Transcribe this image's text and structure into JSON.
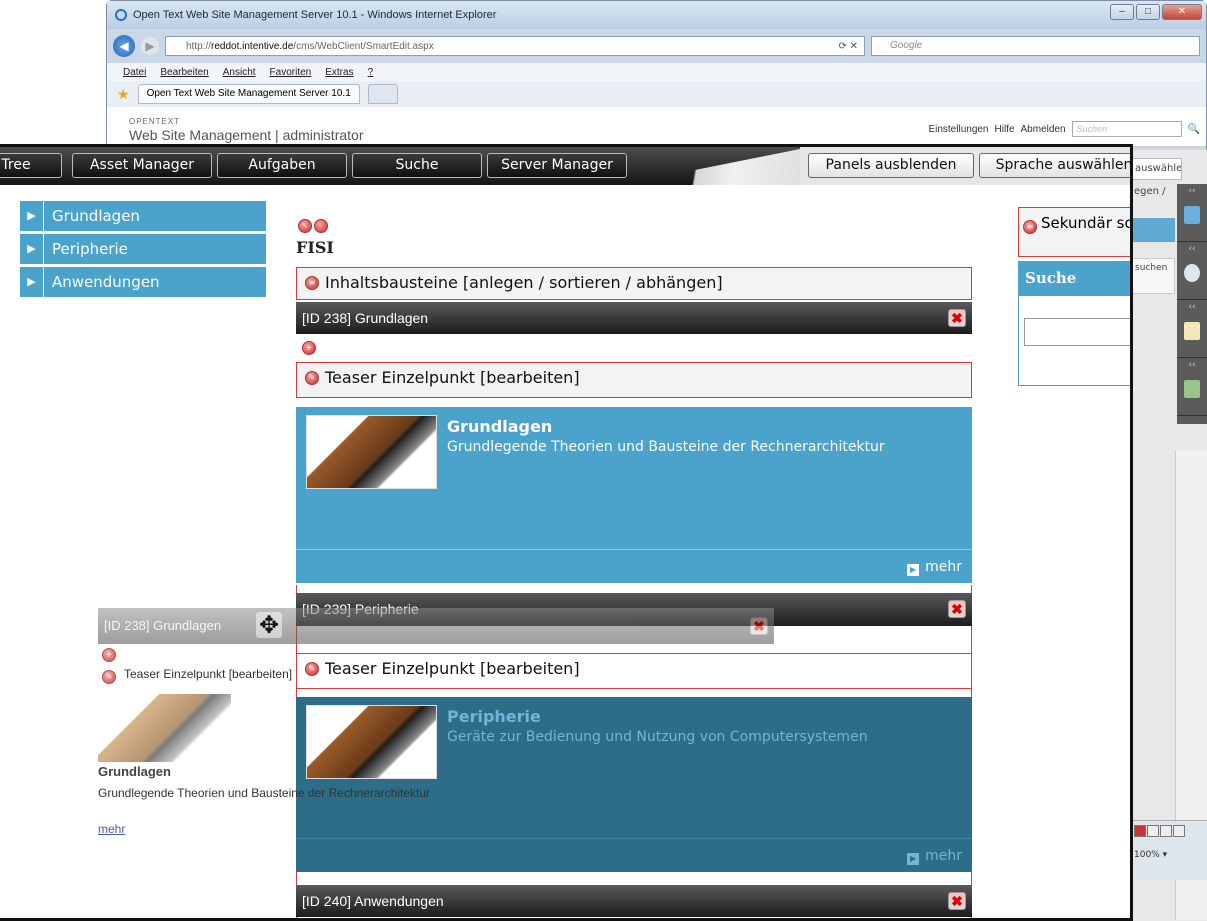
{
  "ie": {
    "title": "Open Text Web Site Management Server 10.1 - Windows Internet Explorer",
    "url_prefix": "http://",
    "url_host": "reddot.intentive.de",
    "url_path": "/cms/WebClient/SmartEdit.aspx",
    "search_placeholder": "Google",
    "menu": [
      "Datei",
      "Bearbeiten",
      "Ansicht",
      "Favoriten",
      "Extras",
      "?"
    ],
    "tab_title": "Open Text Web Site Management Server 10.1"
  },
  "wsm": {
    "brand_small": "OPENTEXT",
    "title": "Web Site Management | administrator",
    "settings": "Einstellungen",
    "help": "Hilfe",
    "logout": "Abmelden",
    "search_placeholder": "Suchen"
  },
  "right_strip": {
    "select_label": "auswählen",
    "crumb": "egen /",
    "suchen": "suchen",
    "zoom": "100%"
  },
  "toolbar": {
    "tree": "Tree",
    "asset_manager": "Asset Manager",
    "aufgaben": "Aufgaben",
    "suche": "Suche",
    "server_manager": "Server Manager",
    "panels": "Panels ausblenden",
    "sprache": "Sprache auswählen"
  },
  "nav": [
    "Grundlagen",
    "Peripherie",
    "Anwendungen"
  ],
  "page": {
    "heading": "FISI",
    "container_label": "Inhaltsbausteine [anlegen / sortieren / abhängen]",
    "teaser_label": "Teaser Einzelpunkt [bearbeiten]",
    "mehr": "mehr",
    "blocks": [
      {
        "bar": "[ID 238] Grundlagen",
        "title": "Grundlagen",
        "desc": "Grundlegende Theorien und Bausteine der Rechnerarchitektur"
      },
      {
        "bar": "[ID 239] Peripherie",
        "title": "Peripherie",
        "desc": "Geräte zur Bedienung und Nutzung von Computersystemen"
      },
      {
        "bar": "[ID 240] Anwendungen"
      }
    ]
  },
  "right_panel": {
    "header": "Sekundär sortieren / a",
    "suche": "Suche"
  },
  "ghost": {
    "bar": "[ID 238] Grundlagen",
    "teaser": "Teaser Einzelpunkt [bearbeiten]",
    "title": "Grundlagen",
    "desc": "Grundlegende Theorien und Bausteine der Rechnerarchitektur",
    "mehr": "mehr"
  }
}
